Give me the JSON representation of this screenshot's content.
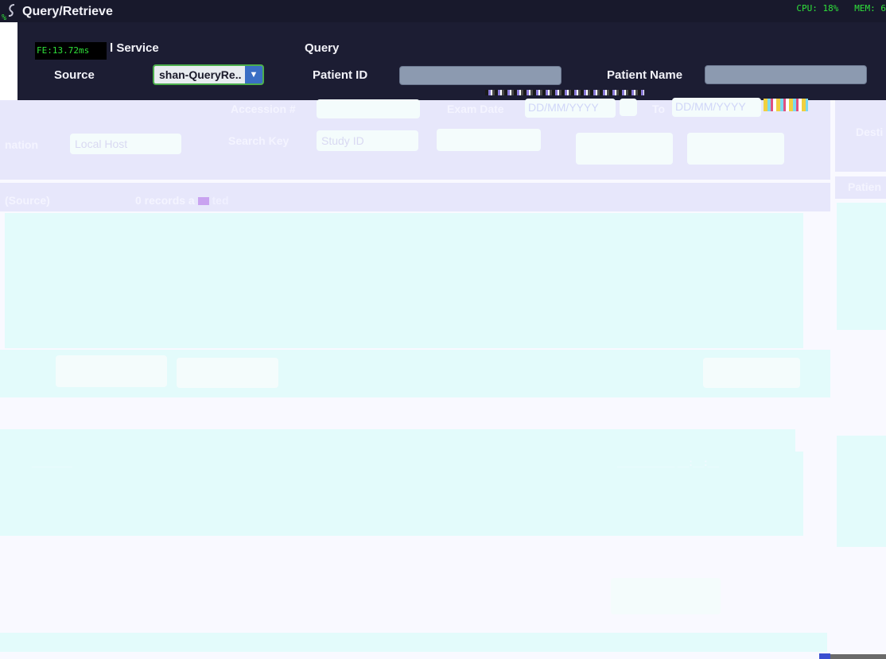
{
  "window": {
    "title": "Query/Retrieve",
    "perf_cpu": "CPU: 18%   MEM: 6",
    "perf_frame": "FE:13.72ms",
    "perf_pct": "%"
  },
  "header": {
    "service_label": "l Service",
    "source_label": "Source",
    "source_value": "shan-QueryRe..",
    "query_label": "Query",
    "patient_id_label": "Patient ID",
    "patient_name_label": "Patient Name"
  },
  "filters": {
    "accession_label": "Accession #",
    "exam_date_label": "Exam Date",
    "date_from_placeholder": "DD/MM/YYYY",
    "to_label": "To",
    "date_to_placeholder": "DD/MM/YYYY",
    "destination_label": "nation",
    "destination_value": "Local Host",
    "search_key_label": "Search Key",
    "search_key_value": "Study ID",
    "right_destination_label": "Desti"
  },
  "results": {
    "section_label": "(Source)",
    "records_text": "0 records a",
    "records_suffix": "ted",
    "right_patient_label": "Patien"
  },
  "list": {
    "row_id": "_______",
    "row_date": "__________ __:__:__"
  },
  "colors": {
    "header_bg": "#1c1d33",
    "topbar_bg": "#18192c",
    "perf_green": "#2fe23a",
    "source_border": "#4cae4c",
    "dropdown_arrow": "#3a6fc4",
    "washed_lavender": "#e7e7fb",
    "washed_cyan": "#e3fbfb"
  },
  "icons": {
    "app": "app-icon",
    "dropdown": "chevron-down-icon",
    "calendar": "calendar-icon"
  }
}
